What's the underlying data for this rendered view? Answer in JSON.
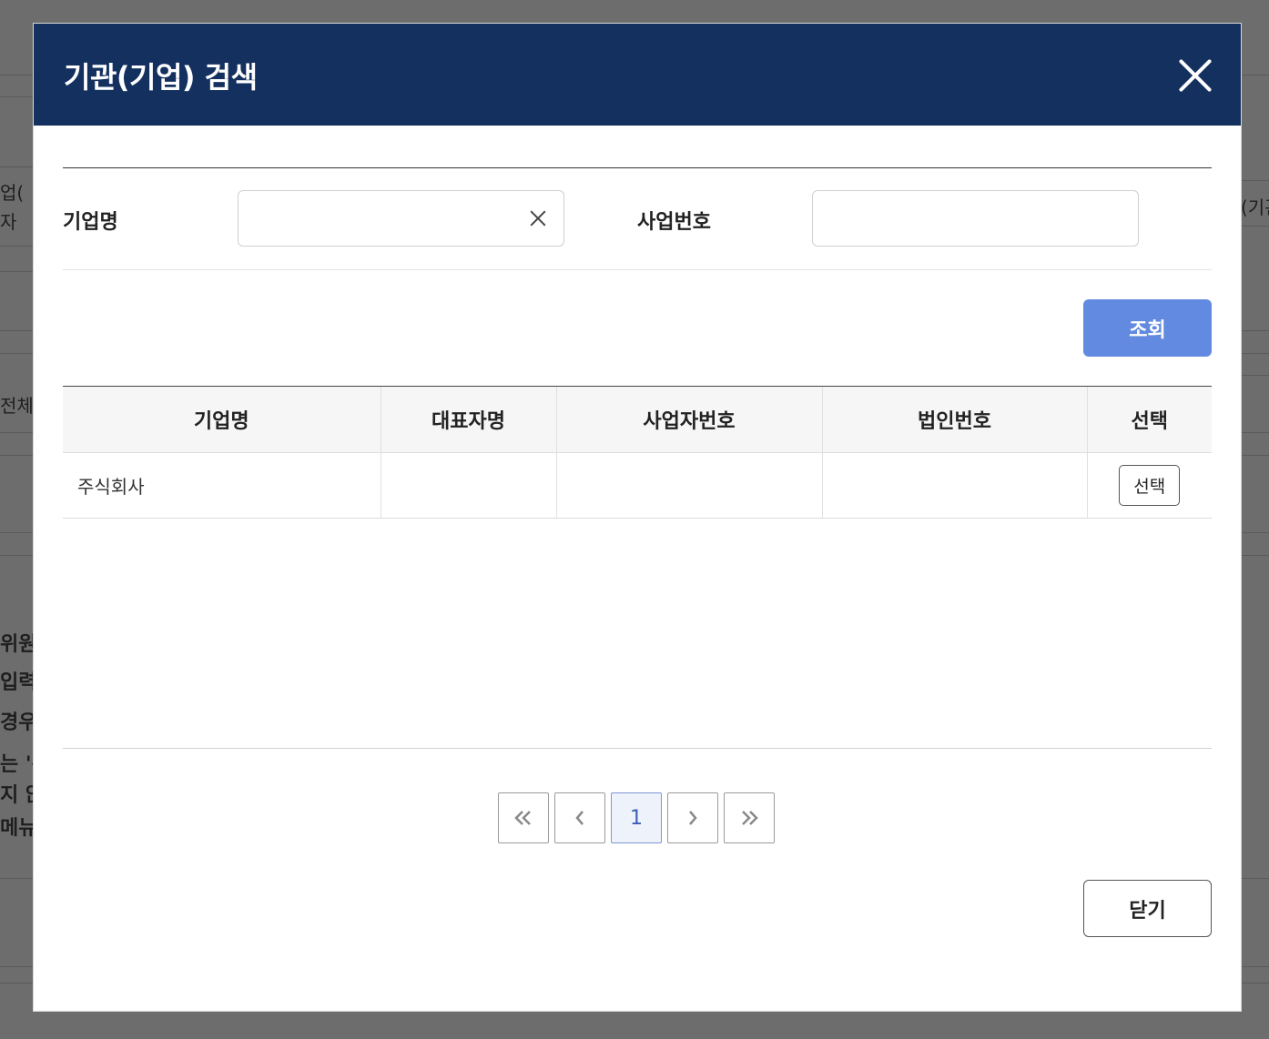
{
  "background": {
    "left_fragments": [
      "업(",
      "자 ",
      "전체",
      "위원",
      "입력",
      "경우,",
      "는 '총",
      "지 않",
      "메뉴"
    ],
    "right_fragments": [
      "(기관"
    ]
  },
  "modal": {
    "title": "기관(기업) 검색",
    "close_icon": "close-icon"
  },
  "search": {
    "company_label": "기업명",
    "company_value": "",
    "business_label": "사업번호",
    "business_value": "",
    "search_button": "조회"
  },
  "table": {
    "headers": [
      "기업명",
      "대표자명",
      "사업자번호",
      "법인번호",
      "선택"
    ],
    "rows": [
      {
        "company": "주식회사",
        "representative": "",
        "business_number": "",
        "corporate_number": "",
        "select_label": "선택"
      }
    ]
  },
  "pagination": {
    "first": "«",
    "prev": "‹",
    "current": "1",
    "next": "›",
    "last": "»"
  },
  "footer": {
    "close_button": "닫기"
  }
}
